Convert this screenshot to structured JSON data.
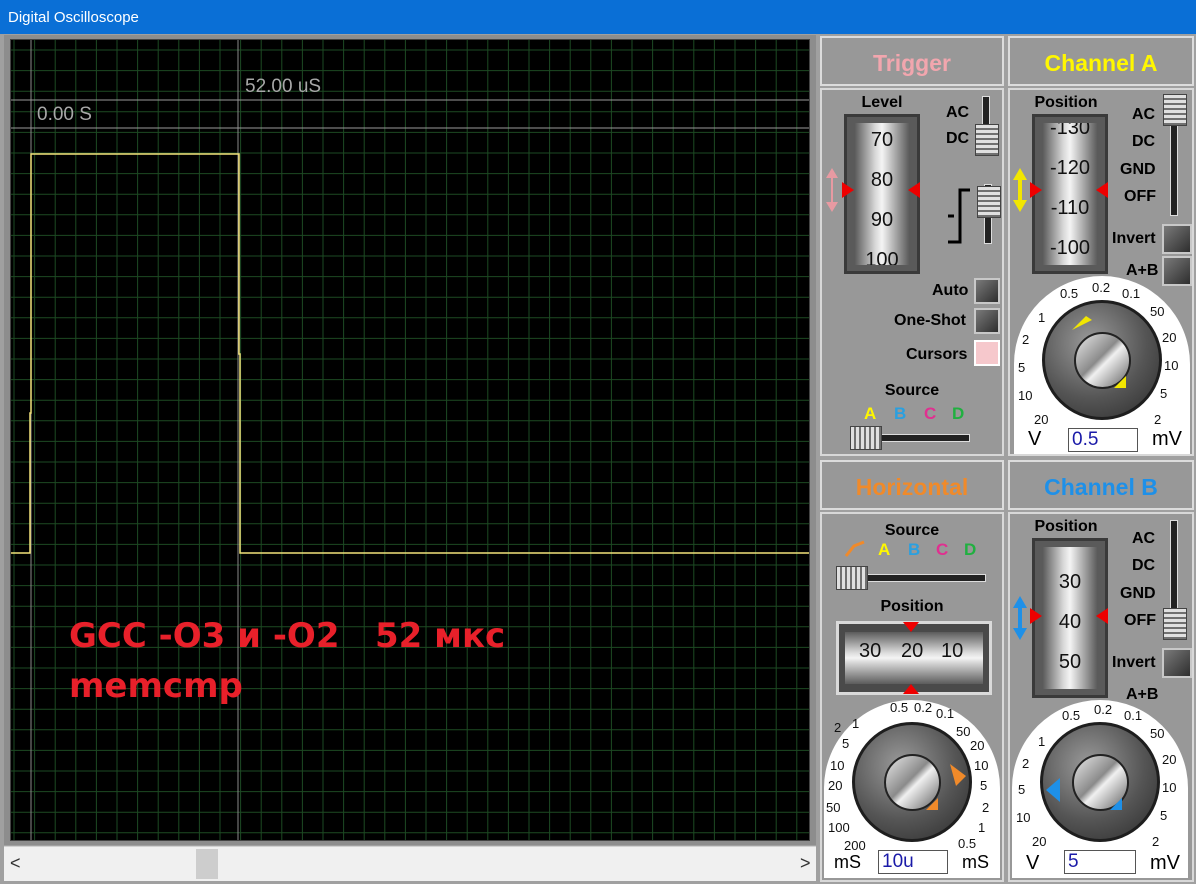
{
  "window": {
    "title": "Digital Oscilloscope"
  },
  "screen": {
    "cursor_left_label": "0.00 S",
    "cursor_right_label": "52.00 uS",
    "overlay_line1": "GCC -O3 и -O2   52 мкс",
    "overlay_line2": "memcmp",
    "trace_color": "#f2e27a",
    "grid_color": "#1d4a23"
  },
  "trigger": {
    "title": "Trigger",
    "title_color": "#f2a6ae",
    "level_label": "Level",
    "level_drum": [
      "70",
      "80",
      "90",
      "100"
    ],
    "ac_label": "AC",
    "dc_label": "DC",
    "auto_label": "Auto",
    "oneshot_label": "One-Shot",
    "cursors_label": "Cursors",
    "source_label": "Source",
    "source_letters": [
      "A",
      "B",
      "C",
      "D"
    ]
  },
  "channel_a": {
    "title": "Channel A",
    "title_color": "#fff700",
    "position_label": "Position",
    "position_drum": [
      "-130",
      "-120",
      "-110",
      "-100"
    ],
    "coupling": [
      "AC",
      "DC",
      "GND",
      "OFF"
    ],
    "invert_label": "Invert",
    "aplusb_label": "A+B",
    "dial_ticks": [
      "1",
      "0.5",
      "0.2",
      "0.1",
      "50",
      "20",
      "10",
      "5",
      "2",
      "2",
      "5",
      "10",
      "20"
    ],
    "unit_left": "V",
    "unit_right": "mV",
    "value": "0.5"
  },
  "horizontal": {
    "title": "Horizontal",
    "title_color": "#f08a2a",
    "source_label": "Source",
    "source_letters": [
      "A",
      "B",
      "C",
      "D"
    ],
    "position_label": "Position",
    "position_drum": [
      "30",
      "20",
      "10"
    ],
    "dial_ticks": [
      "1",
      "0.5",
      "0.2",
      "0.1",
      "50",
      "20",
      "10",
      "5",
      "2",
      "1",
      "0.5",
      "2",
      "5",
      "10",
      "20",
      "50",
      "100",
      "200"
    ],
    "unit_left": "mS",
    "unit_right": "mS",
    "value": "10u"
  },
  "channel_b": {
    "title": "Channel B",
    "title_color": "#1e90e8",
    "position_label": "Position",
    "position_drum": [
      "30",
      "40",
      "50"
    ],
    "coupling": [
      "AC",
      "DC",
      "GND",
      "OFF"
    ],
    "invert_label": "Invert",
    "aplusb_label": "A+B",
    "dial_ticks": [
      "1",
      "0.5",
      "0.2",
      "0.1",
      "50",
      "20",
      "10",
      "5",
      "2",
      "2",
      "5",
      "10",
      "20"
    ],
    "unit_left": "V",
    "unit_right": "mV",
    "value": "5"
  },
  "scrollbar": {
    "left_arrow": "<",
    "right_arrow": ">"
  }
}
